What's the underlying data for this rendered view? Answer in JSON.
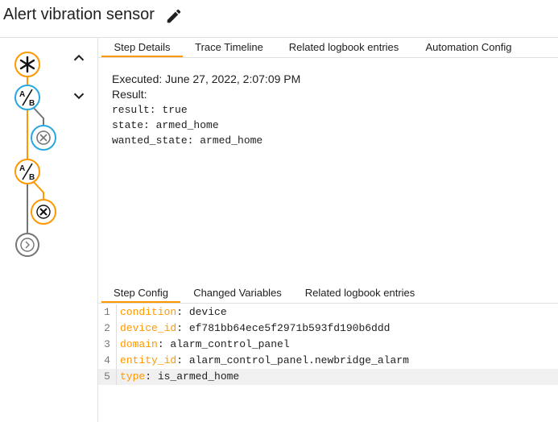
{
  "header": {
    "title": "Alert vibration sensor"
  },
  "top_tabs": [
    "Step Details",
    "Trace Timeline",
    "Related logbook entries",
    "Automation Config"
  ],
  "details": {
    "executed": "Executed: June 27, 2022, 2:07:09 PM",
    "result_label": "Result:",
    "lines": [
      "result: true",
      "state: armed_home",
      "wanted_state: armed_home"
    ]
  },
  "bottom_tabs": [
    "Step Config",
    "Changed Variables",
    "Related logbook entries"
  ],
  "code": [
    {
      "num": "1",
      "key": "condition",
      "value": ": device"
    },
    {
      "num": "2",
      "key": "device_id",
      "value": ": ef781bb64ece5f2971b593fd190b6ddd"
    },
    {
      "num": "3",
      "key": "domain",
      "value": ": alarm_control_panel"
    },
    {
      "num": "4",
      "key": "entity_id",
      "value": ": alarm_control_panel.newbridge_alarm"
    },
    {
      "num": "5",
      "key": "type",
      "value": ": is_armed_home"
    }
  ],
  "colors": {
    "accent": "#ff9800",
    "blue": "#29a8e0",
    "gray": "#757575"
  },
  "icons": [
    "edit-icon",
    "chevron-up-icon",
    "chevron-down-icon",
    "trigger-icon",
    "condition-ab-icon",
    "cancel-icon",
    "chevron-right-icon"
  ]
}
